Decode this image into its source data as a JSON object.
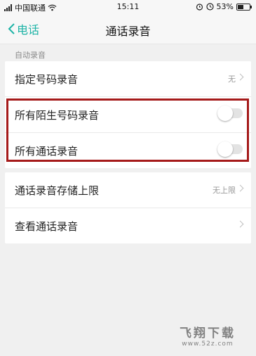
{
  "status_bar": {
    "carrier": "中国联通",
    "time": "15:11",
    "battery": "53%",
    "battery_level": 0.53
  },
  "nav": {
    "back_label": "电话",
    "title": "通话录音"
  },
  "section_header": "自动录音",
  "card1": {
    "row1": {
      "label": "指定号码录音",
      "value": "无"
    },
    "row2": {
      "label": "所有陌生号码录音",
      "enabled": false
    },
    "row3": {
      "label": "所有通话录音",
      "enabled": false
    }
  },
  "card2": {
    "row1": {
      "label": "通话录音存储上限",
      "value": "无上限"
    },
    "row2": {
      "label": "查看通话录音"
    }
  },
  "watermark": {
    "main": "飞翔下载",
    "url": "www.52z.com"
  },
  "colors": {
    "accent": "#1db3a6",
    "highlight_border": "#a51a1a",
    "background": "#f0f0f0"
  }
}
